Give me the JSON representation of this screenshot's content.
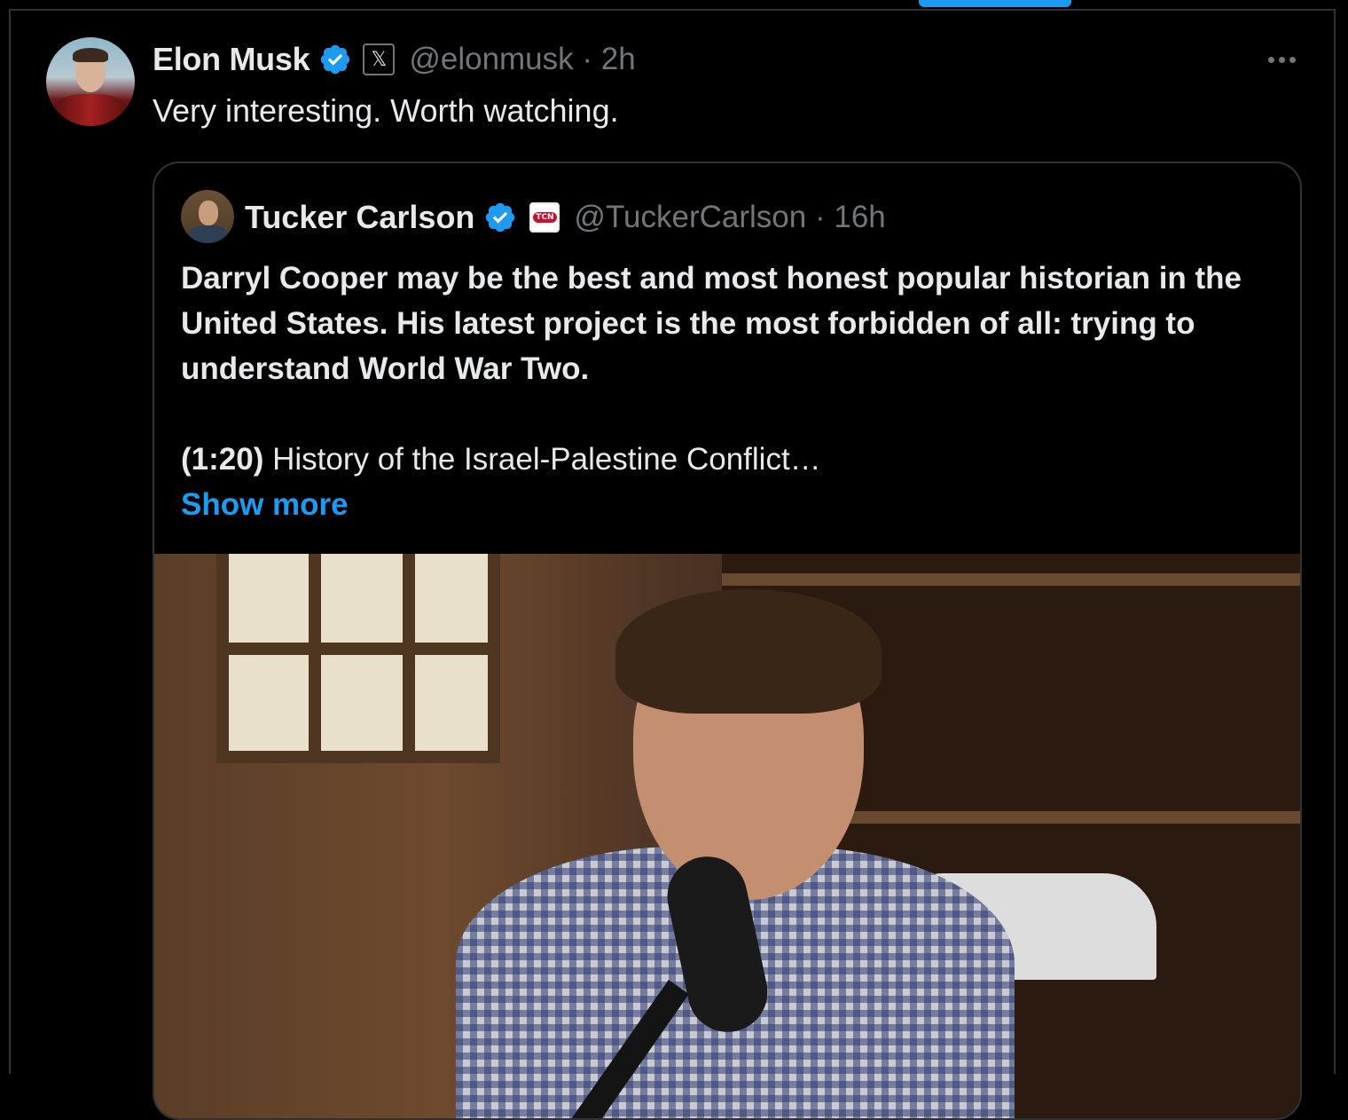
{
  "tweet": {
    "author_name": "Elon Musk",
    "handle": "@elonmusk",
    "separator": "·",
    "time": "2h",
    "text": "Very interesting. Worth watching."
  },
  "quoted_tweet": {
    "author_name": "Tucker Carlson",
    "handle": "@TuckerCarlson",
    "separator": "·",
    "time": "16h",
    "affiliate_badge": "TCN",
    "text_bold": "Darryl Cooper may be the best and most honest popular historian in the United States. His latest project is the most forbidden of all: trying to understand World War Two.",
    "timestamp_bold": "(1:20)",
    "chapter_text": " History of the Israel-Palestine Conflict…",
    "show_more": "Show more"
  },
  "colors": {
    "background": "#000000",
    "text": "#e7e9ea",
    "muted": "#71767b",
    "accent": "#1d9bf0",
    "border": "#2f3336"
  },
  "icons": [
    "verified-badge-icon",
    "x-affiliate-icon",
    "tcn-affiliate-icon",
    "more-options-icon"
  ]
}
